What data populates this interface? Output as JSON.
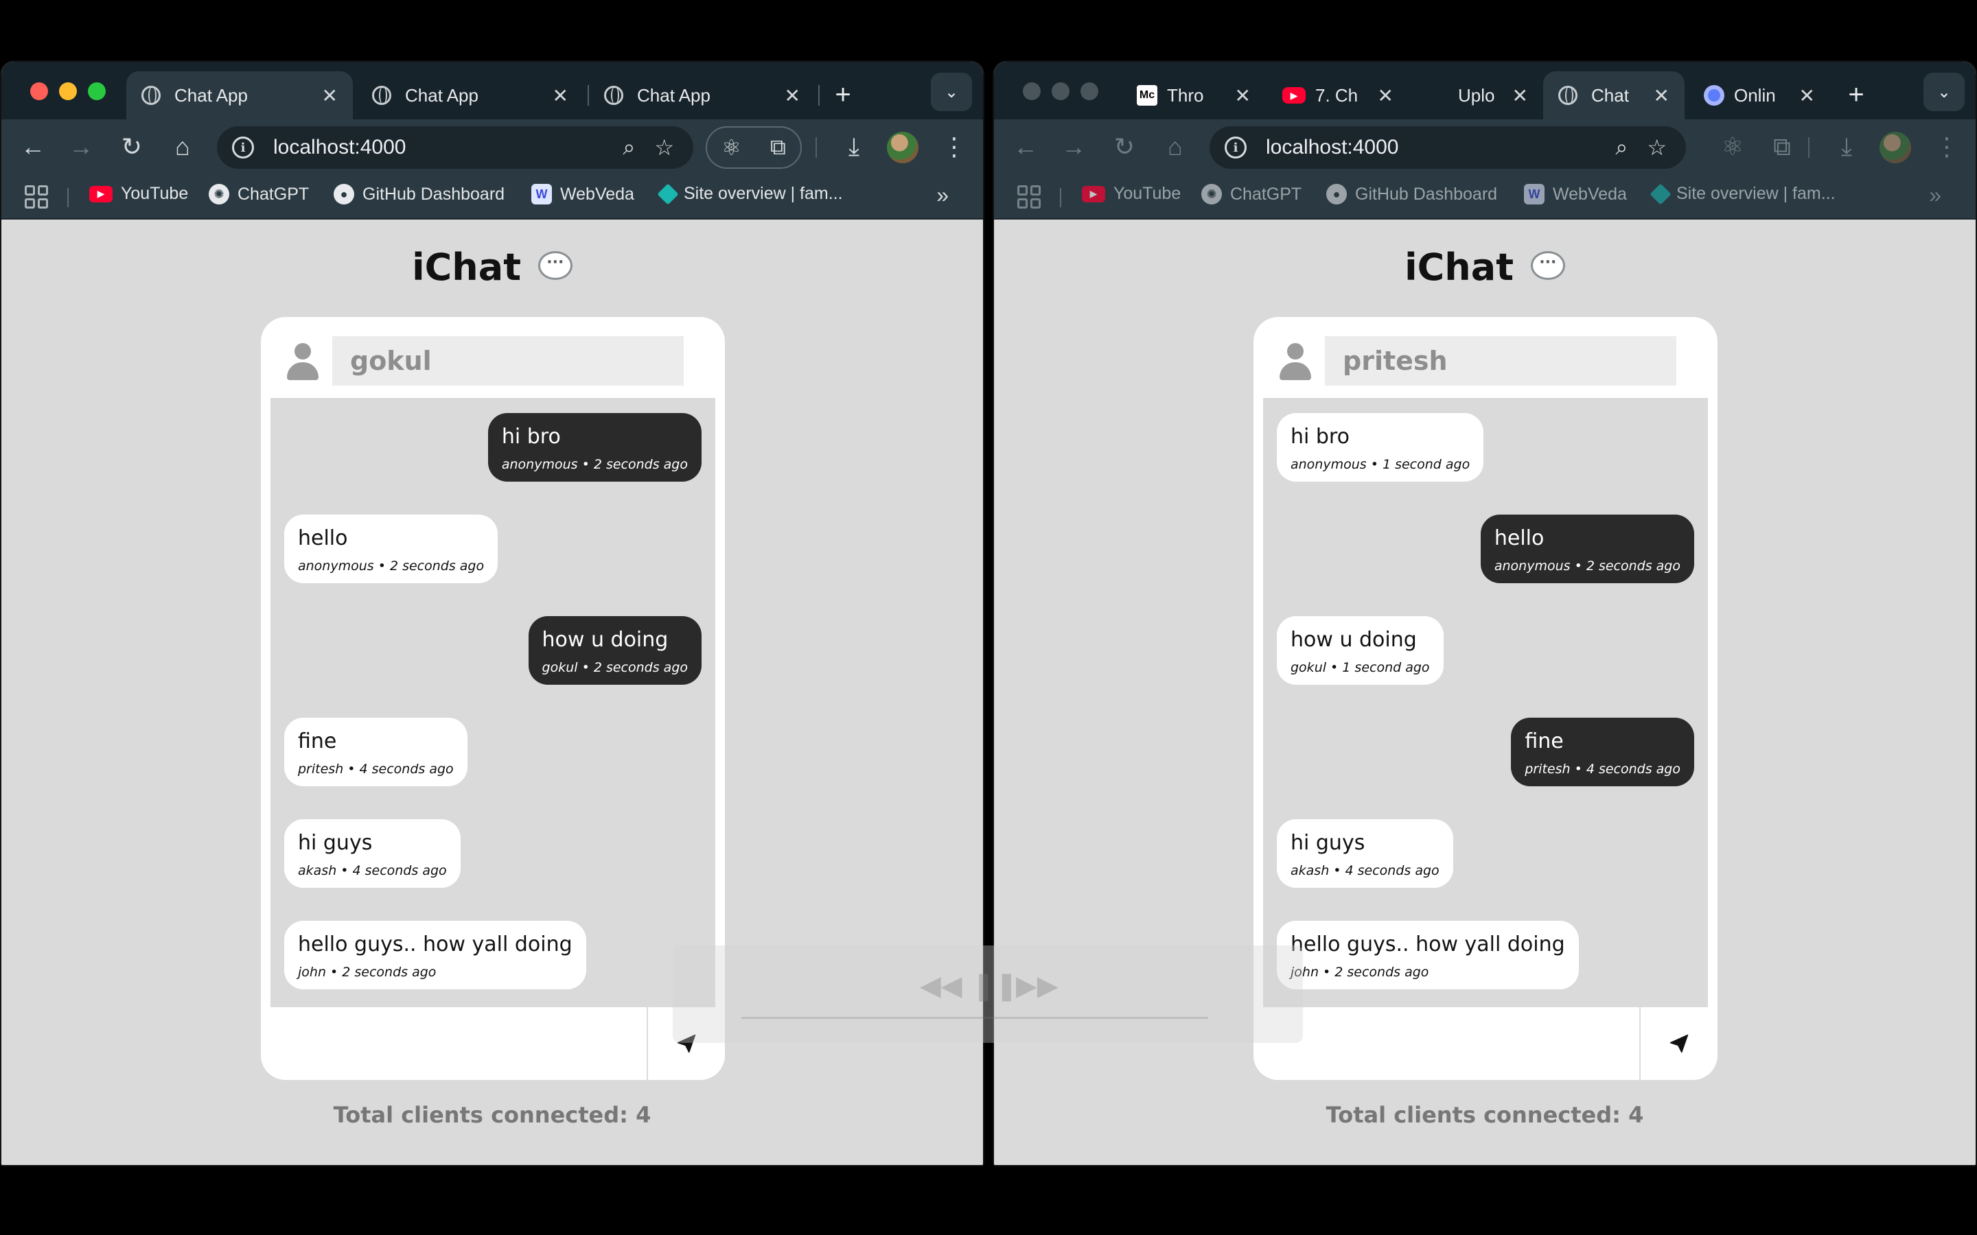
{
  "left_window": {
    "tabs": [
      {
        "title": "Chat App",
        "active": true
      },
      {
        "title": "Chat App",
        "active": false
      },
      {
        "title": "Chat App",
        "active": false
      }
    ],
    "url": "localhost:4000",
    "bookmarks": [
      "YouTube",
      "ChatGPT",
      "GitHub Dashboard",
      "WebVeda",
      "Site overview | fam..."
    ],
    "app_title": "iChat",
    "username": "gokul",
    "messages": [
      {
        "side": "outgoing",
        "text": "hi bro",
        "meta": "anonymous • 2 seconds ago"
      },
      {
        "side": "incoming",
        "text": "hello",
        "meta": "anonymous • 2 seconds ago"
      },
      {
        "side": "outgoing",
        "text": "how u doing",
        "meta": "gokul • 2 seconds ago"
      },
      {
        "side": "incoming",
        "text": "fine",
        "meta": "pritesh • 4 seconds ago"
      },
      {
        "side": "incoming",
        "text": "hi guys",
        "meta": "akash • 4 seconds ago"
      },
      {
        "side": "incoming",
        "text": "hello guys.. how yall doing",
        "meta": "john • 2 seconds ago"
      }
    ],
    "clients_text": "Total clients connected: 4"
  },
  "right_window": {
    "tabs": [
      {
        "title": "Thro",
        "active": false,
        "icon": "Mc"
      },
      {
        "title": "7. Ch",
        "active": false,
        "icon": "yt"
      },
      {
        "title": "Uplo",
        "active": false,
        "icon": ""
      },
      {
        "title": "Chat",
        "active": true,
        "icon": "globe"
      },
      {
        "title": "Onlin",
        "active": false,
        "icon": "chrome"
      }
    ],
    "url": "localhost:4000",
    "bookmarks": [
      "YouTube",
      "ChatGPT",
      "GitHub Dashboard",
      "WebVeda",
      "Site overview | fam..."
    ],
    "app_title": "iChat",
    "username": "pritesh",
    "messages": [
      {
        "side": "incoming",
        "text": "hi bro",
        "meta": "anonymous • 1 second ago"
      },
      {
        "side": "outgoing",
        "text": "hello",
        "meta": "anonymous • 2 seconds ago"
      },
      {
        "side": "incoming",
        "text": "how u doing",
        "meta": "gokul • 1 second ago"
      },
      {
        "side": "outgoing",
        "text": "fine",
        "meta": "pritesh • 4 seconds ago"
      },
      {
        "side": "incoming",
        "text": "hi guys",
        "meta": "akash • 4 seconds ago"
      },
      {
        "side": "incoming",
        "text": "hello guys.. how yall doing",
        "meta": "john • 2 seconds ago"
      }
    ],
    "clients_text": "Total clients connected: 4"
  },
  "colors": {
    "outgoing_bubble": "#2a2a2a",
    "incoming_bubble": "#ffffff",
    "page_bg": "#dadada",
    "browser_chrome": "#2b3a42"
  }
}
